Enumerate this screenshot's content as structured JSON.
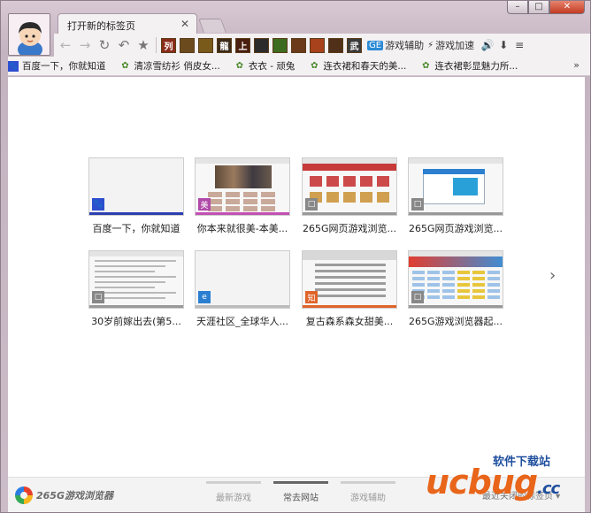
{
  "window": {
    "controls": {
      "minimize": "–",
      "maximize": "□",
      "close": "✕"
    }
  },
  "tab": {
    "title": "打开新的标签页",
    "close": "✕"
  },
  "toolbar": {
    "back": "←",
    "forward": "→",
    "reload": "↻",
    "undo": "↶",
    "star": "★",
    "games": [
      "列",
      "",
      "",
      "龍",
      "上",
      "",
      "",
      "",
      "",
      "",
      "武"
    ],
    "game_colors": [
      "#8a2b1a",
      "#6b4a1d",
      "#7a5a1a",
      "#3b2b1a",
      "#4a1e10",
      "#2c2c2c",
      "#3d6b1f",
      "#6b3a1a",
      "#a8421c",
      "#503018",
      "#3b3b3b"
    ],
    "game_helper": "游戏辅助",
    "game_speed": "游戏加速",
    "right_icons": [
      "🔊",
      "⬇",
      "≡"
    ]
  },
  "bookmarks": [
    {
      "label": "百度一下，你就知道",
      "icon": "paw-icon",
      "color": "#2d4fcf"
    },
    {
      "label": "清凉雪纺衫 俏皮女...",
      "icon": "bow-icon",
      "color": "#4a8a2a"
    },
    {
      "label": "衣衣 - 顽兔",
      "icon": "bow-icon",
      "color": "#4a8a2a"
    },
    {
      "label": "连衣裙和春天的美...",
      "icon": "bow-icon",
      "color": "#4a8a2a"
    },
    {
      "label": "连衣裙彰显魅力所...",
      "icon": "bow-icon",
      "color": "#4a8a2a"
    }
  ],
  "bookmarks_more": "»",
  "tiles": [
    {
      "label": "百度一下，你就知道",
      "bar": "#2b3fb0",
      "fav": "#2d4fcf",
      "fav_glyph": "🐾",
      "kind": "blank"
    },
    {
      "label": "你本来就很美-本美...",
      "bar": "#c34fb3",
      "fav": "#b04aa8",
      "fav_glyph": "美",
      "kind": "photo"
    },
    {
      "label": "265G网页游戏浏览...",
      "bar": "#999999",
      "fav": "#888888",
      "fav_glyph": "□",
      "kind": "grid"
    },
    {
      "label": "265G网页游戏浏览...",
      "bar": "#999999",
      "fav": "#888888",
      "fav_glyph": "□",
      "kind": "dialog"
    },
    {
      "label": "30岁前嫁出去(第5...",
      "bar": "#999999",
      "fav": "#888888",
      "fav_glyph": "□",
      "kind": "text"
    },
    {
      "label": "天涯社区_全球华人...",
      "bar": "#bbbbbb",
      "fav": "#2a7fd0",
      "fav_glyph": "e",
      "kind": "blank"
    },
    {
      "label": "复古森系森女甜美...",
      "bar": "#e0642a",
      "fav": "#e0642a",
      "fav_glyph": "知",
      "kind": "article"
    },
    {
      "label": "265G游戏浏览器起...",
      "bar": "#999999",
      "fav": "#888888",
      "fav_glyph": "□",
      "kind": "table"
    }
  ],
  "next_page": "›",
  "footer": {
    "logo": "265G游戏浏览器",
    "tabs": [
      "最新游戏",
      "常去网站",
      "游戏辅助"
    ],
    "active_tab": 1,
    "dropdown": "最近关闭的标签页 ▾"
  },
  "watermark": {
    "brand": "ucbug",
    "tagline": "软件下载站",
    "suffix": ".cc"
  }
}
